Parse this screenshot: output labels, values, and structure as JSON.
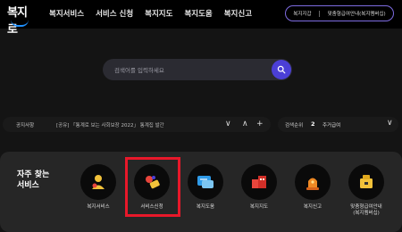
{
  "header": {
    "logo_text": "복지로",
    "nav": [
      "복지서비스",
      "서비스 신청",
      "복지지도",
      "복지도움",
      "복지신고"
    ],
    "util": [
      "복지지갑",
      "맞춤형급여안내(복지멤버십)"
    ]
  },
  "search": {
    "placeholder": "검색어를 입력하세요"
  },
  "notice": {
    "label": "공지사항",
    "text": "[공유] 「통계로 보는 사회보장 2022」 통계집 발간",
    "prev": "∨",
    "next": "∧",
    "add": "+"
  },
  "ranking": {
    "label": "검색순위",
    "rank": "2",
    "term": "주거급여",
    "toggle": "∨"
  },
  "favorites": {
    "title": "자주 찾는\n서비스",
    "items": [
      {
        "label": "복지서비스",
        "icon": "welfare-service-icon"
      },
      {
        "label": "서비스신청",
        "icon": "service-apply-icon"
      },
      {
        "label": "복지도움",
        "icon": "welfare-help-icon"
      },
      {
        "label": "복지지도",
        "icon": "welfare-map-icon"
      },
      {
        "label": "복지신고",
        "icon": "welfare-report-icon"
      },
      {
        "label": "맞춤형급여안내\n(복지멤버십)",
        "icon": "custom-benefit-icon"
      }
    ]
  },
  "colors": {
    "accent": "#4b3fd6",
    "highlight": "#e8182a",
    "background": "#141414"
  }
}
